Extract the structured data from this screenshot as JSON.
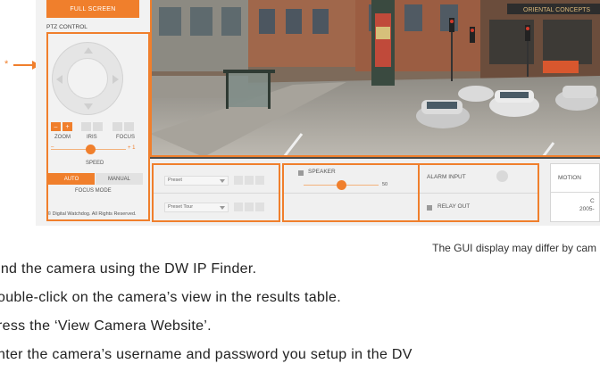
{
  "panel": {
    "full_screen": "FULL SCREEN",
    "ptz_title": "PTZ CONTROL",
    "zoom_minus": "–",
    "zoom_plus": "+",
    "zoom": "ZOOM",
    "iris": "IRIS",
    "focus": "FOCUS",
    "speed_minus": "–",
    "speed_plus": "+ 1",
    "speed": "SPEED",
    "auto": "AUTO",
    "manual": "MANUAL",
    "focus_mode": "FOCUS MODE",
    "copyright": "© Digital Watchdog. All Rights Reserved."
  },
  "bottom": {
    "preset": "Preset",
    "preset_tour": "Preset Tour",
    "speaker": "SPEAKER",
    "speaker_value": "50",
    "speaker_level": 0.5,
    "alarm_input": "ALARM INPUT",
    "relay_out": "RELAY OUT",
    "motion": "MOTION",
    "cam_text_1": "C",
    "cam_text_2": "2005-"
  },
  "annotation": {
    "marker": "*"
  },
  "caption": "The GUI display may differ by cam",
  "steps": [
    "ind the camera using the DW IP Finder.",
    "ouble-click on the camera’s view in the results table.",
    "ress the ‘View Camera Website’.",
    "nter the camera’s username and password you setup in the DV"
  ],
  "colors": {
    "accent": "#f07f2c",
    "panel_bg": "#f2f2f2"
  }
}
